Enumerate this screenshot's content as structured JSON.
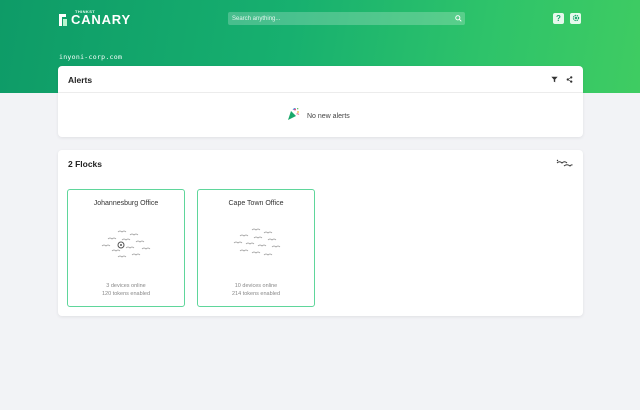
{
  "header": {
    "logo_brand": "THINKST",
    "logo_name": "CANARY",
    "search_placeholder": "Search anything...",
    "help_label": "?",
    "settings_icon": "gear-icon"
  },
  "domain": "inyoni-corp.com",
  "alerts": {
    "title": "Alerts",
    "empty_message": "No new alerts",
    "empty_icon": "party-popper-icon",
    "actions": [
      "filter-icon",
      "share-icon"
    ]
  },
  "flocks": {
    "title": "2 Flocks",
    "header_icon": "birds-icon",
    "items": [
      {
        "name": "Johannesburg Office",
        "devices": "3 devices online",
        "tokens": "120 tokens enabled"
      },
      {
        "name": "Cape Town Office",
        "devices": "10 devices online",
        "tokens": "214 tokens enabled"
      }
    ]
  },
  "colors": {
    "brand_green": "#12a568",
    "flock_border": "#5fd69b"
  }
}
